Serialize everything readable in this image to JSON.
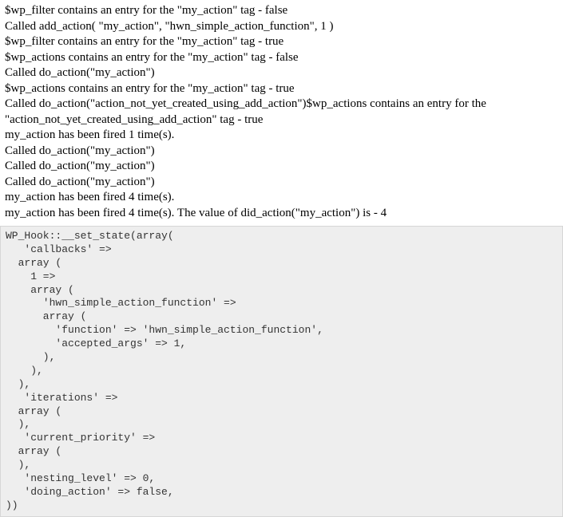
{
  "output": {
    "lines": [
      "$wp_filter contains an entry for the \"my_action\" tag - false",
      "Called add_action( \"my_action\", \"hwn_simple_action_function\", 1 )",
      "$wp_filter contains an entry for the \"my_action\" tag - true",
      "$wp_actions contains an entry for the \"my_action\" tag - false",
      "Called do_action(\"my_action\")",
      "$wp_actions contains an entry for the \"my_action\" tag - true",
      "Called do_action(\"action_not_yet_created_using_add_action\")$wp_actions contains an entry for the \"action_not_yet_created_using_add_action\" tag - true",
      "my_action has been fired 1 time(s).",
      "Called do_action(\"my_action\")",
      "Called do_action(\"my_action\")",
      "Called do_action(\"my_action\")",
      "my_action has been fired 4 time(s).",
      "my_action has been fired 4 time(s). The value of did_action(\"my_action\") is - 4"
    ]
  },
  "code": {
    "text": "WP_Hook::__set_state(array(\n   'callbacks' =>\n  array (\n    1 =>\n    array (\n      'hwn_simple_action_function' =>\n      array (\n        'function' => 'hwn_simple_action_function',\n        'accepted_args' => 1,\n      ),\n    ),\n  ),\n   'iterations' =>\n  array (\n  ),\n   'current_priority' =>\n  array (\n  ),\n   'nesting_level' => 0,\n   'doing_action' => false,\n))"
  }
}
